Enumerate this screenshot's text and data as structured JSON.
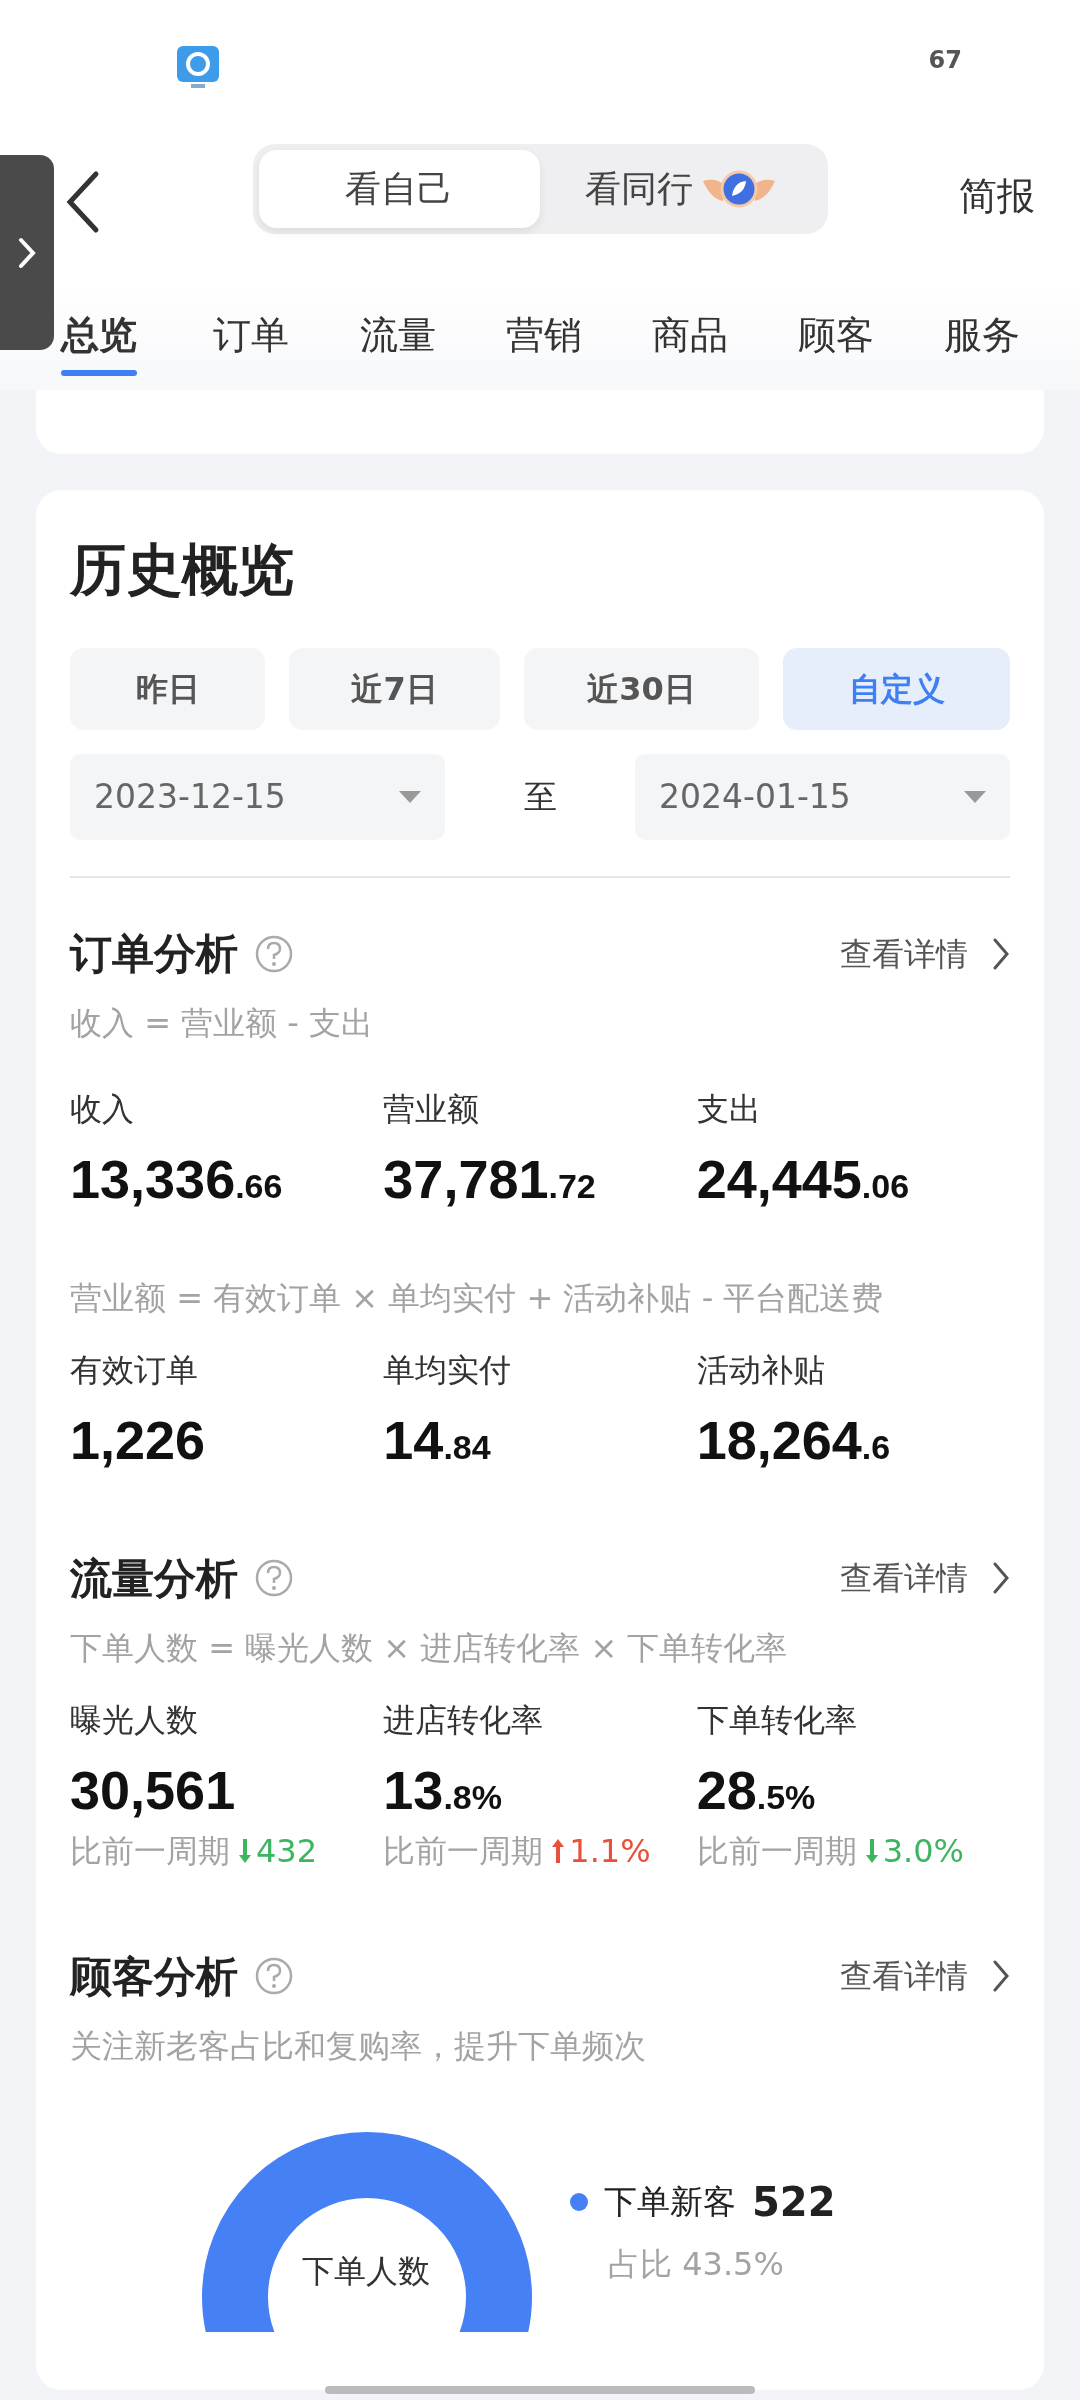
{
  "status_bar": {
    "battery": "67"
  },
  "header": {
    "segments": [
      {
        "label": "看自己",
        "selected": true
      },
      {
        "label": "看同行",
        "selected": false,
        "badge": true
      }
    ],
    "action": "简报"
  },
  "tabs": [
    {
      "label": "总览",
      "selected": true
    },
    {
      "label": "订单",
      "selected": false
    },
    {
      "label": "流量",
      "selected": false
    },
    {
      "label": "营销",
      "selected": false
    },
    {
      "label": "商品",
      "selected": false
    },
    {
      "label": "顾客",
      "selected": false
    },
    {
      "label": "服务",
      "selected": false
    }
  ],
  "history": {
    "title": "历史概览",
    "periods": [
      {
        "label": "昨日",
        "selected": false
      },
      {
        "label": "近7日",
        "selected": false
      },
      {
        "label": "近30日",
        "selected": false
      },
      {
        "label": "自定义",
        "selected": true
      }
    ],
    "date_from": "2023-12-15",
    "date_separator": "至",
    "date_to": "2024-01-15"
  },
  "sections": [
    {
      "title": "订单分析",
      "detail_link": "查看详情",
      "groups": [
        {
          "formula": "收入 = 营业额 - 支出",
          "metrics": [
            {
              "label": "收入",
              "value": "13,336.66"
            },
            {
              "label": "营业额",
              "value": "37,781.72"
            },
            {
              "label": "支出",
              "value": "24,445.06"
            }
          ]
        },
        {
          "formula": "营业额 = 有效订单 × 单均实付 + 活动补贴 - 平台配送费",
          "metrics": [
            {
              "label": "有效订单",
              "value": "1,226"
            },
            {
              "label": "单均实付",
              "value": "14.84"
            },
            {
              "label": "活动补贴",
              "value": "18,264.6"
            }
          ]
        }
      ]
    },
    {
      "title": "流量分析",
      "detail_link": "查看详情",
      "groups": [
        {
          "formula": "下单人数 = 曝光人数 × 进店转化率 × 下单转化率",
          "metrics": [
            {
              "label": "曝光人数",
              "value": "30,561",
              "change": {
                "label": "比前一周期",
                "increase": false,
                "value": "432"
              }
            },
            {
              "label": "进店转化率",
              "value": "13.8%",
              "change": {
                "label": "比前一周期",
                "increase": true,
                "value": "1.1%"
              }
            },
            {
              "label": "下单转化率",
              "value": "28.5%",
              "change": {
                "label": "比前一周期",
                "increase": false,
                "value": "3.0%"
              }
            }
          ]
        }
      ]
    },
    {
      "title": "顾客分析",
      "detail_link": "查看详情",
      "subtitle": "关注新老客占比和复购率，提升下单频次",
      "donut": {
        "center_label": "下单人数",
        "legend": [
          {
            "label": "下单新客",
            "value": "522",
            "share": "占比 43.5%",
            "color": "#4680f5"
          }
        ]
      }
    }
  ]
}
